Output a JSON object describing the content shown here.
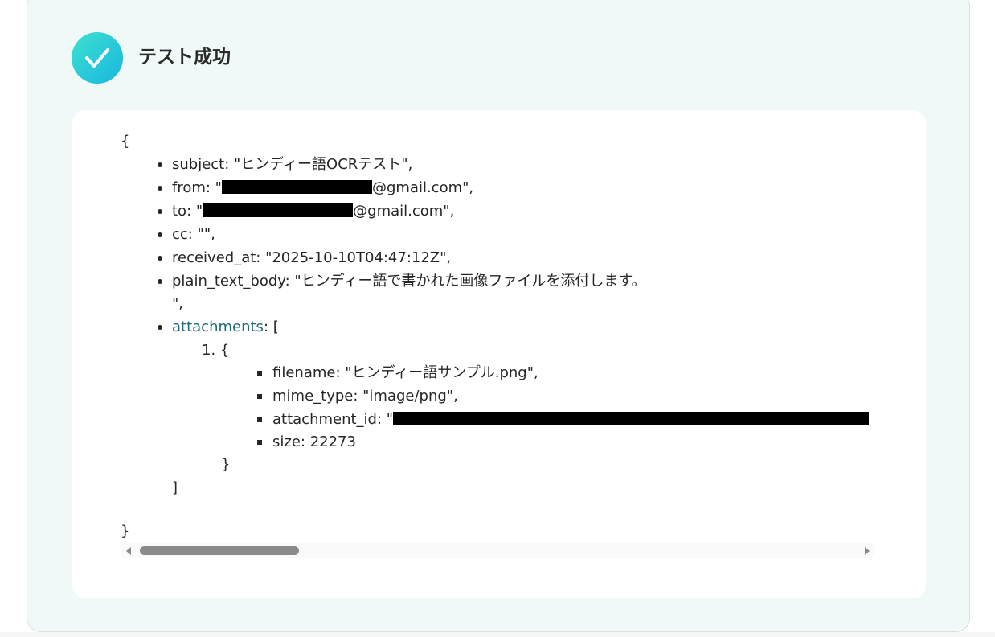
{
  "header": {
    "title": "テスト成功"
  },
  "json_view": {
    "open_brace": "{",
    "close_brace": "}",
    "subject_line": "subject: \"ヒンディー語OCRテスト\",",
    "from_prefix": "from: \"",
    "from_suffix": "@gmail.com\",",
    "to_prefix": "to: \"",
    "to_suffix": "@gmail.com\",",
    "cc_line": "cc: \"\",",
    "received_at_line": "received_at: \"2025-10-10T04:47:12Z\",",
    "plain_text_body_line": "plain_text_body: \"ヒンディー語で書かれた画像ファイルを添付します。",
    "plain_text_body_cont": "\",",
    "attachments_key": "attachments",
    "attachments_open": ": [",
    "item_number": "1.",
    "item_open": "{",
    "filename_line": "filename: \"ヒンディー語サンプル.png\",",
    "mime_type_line": "mime_type: \"image/png\",",
    "attachment_id_prefix": "attachment_id: \"",
    "size_line": "size: 22273",
    "item_close": "}",
    "attachments_close": "]"
  },
  "scrollbar": {
    "scroll_position_fraction": 0.0
  },
  "colors": {
    "accent_start": "#3ee0cf",
    "accent_end": "#17b7e0",
    "panel_bg": "#f1f9f8",
    "link": "#1f6a77"
  }
}
